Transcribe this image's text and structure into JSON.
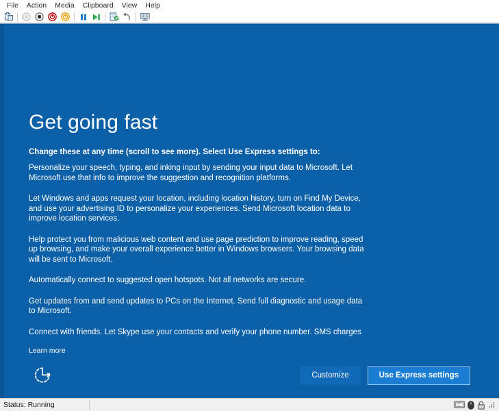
{
  "window": {
    "menus": [
      {
        "label": "File",
        "name": "menu-file"
      },
      {
        "label": "Action",
        "name": "menu-action"
      },
      {
        "label": "Media",
        "name": "menu-media"
      },
      {
        "label": "Clipboard",
        "name": "menu-clipboard"
      },
      {
        "label": "View",
        "name": "menu-view"
      },
      {
        "label": "Help",
        "name": "menu-help"
      }
    ],
    "toolbar": [
      {
        "icon": "clipboard-paste-icon",
        "label": "Clipboard"
      },
      {
        "icon": "ctrl-alt-delete-icon",
        "label": "Ctrl+Alt+Delete"
      },
      {
        "icon": "shutdown-icon",
        "label": "Shut Down"
      },
      {
        "icon": "turn-off-icon",
        "label": "Turn Off"
      },
      {
        "icon": "reset-icon",
        "label": "Reset"
      },
      {
        "icon": "pause-icon",
        "label": "Pause"
      },
      {
        "icon": "start-icon",
        "label": "Start"
      },
      {
        "icon": "checkpoint-icon",
        "label": "Checkpoint"
      },
      {
        "icon": "revert-icon",
        "label": "Revert"
      },
      {
        "icon": "enhanced-session-icon",
        "label": "Enhanced Session"
      }
    ]
  },
  "oobe": {
    "title": "Get going fast",
    "lead": "Change these at any time (scroll to see more). Select Use Express settings to:",
    "paragraphs": [
      "Personalize your speech, typing, and inking input by sending your input data to Microsoft. Let Microsoft use that info to improve the suggestion and recognition platforms.",
      "Let Windows and apps request your location, including location history, turn on Find My Device, and use your advertising ID to personalize your experiences. Send Microsoft location data to improve location services.",
      "Help protect you from malicious web content and use page prediction to improve reading, speed up browsing, and make your overall experience better in Windows browsers. Your browsing data will be sent to Microsoft.",
      "Automatically connect to suggested open hotspots. Not all networks are secure.",
      "Get updates from and send updates to PCs on the Internet. Send full diagnostic and usage data to Microsoft.",
      "Connect with friends. Let Skype use your contacts and verify your phone number. SMS charges may apply."
    ],
    "learn_more": "Learn more",
    "ease_of_access_icon": "ease-of-access-icon",
    "customize_label": "Customize",
    "express_label": "Use Express settings",
    "background_color": "#0c60a8",
    "accent_color": "#1a7fd4"
  },
  "statusbar": {
    "status": "Status: Running",
    "icons": [
      {
        "icon": "screen-icon"
      },
      {
        "icon": "mouse-icon"
      },
      {
        "icon": "lock-icon"
      }
    ]
  }
}
